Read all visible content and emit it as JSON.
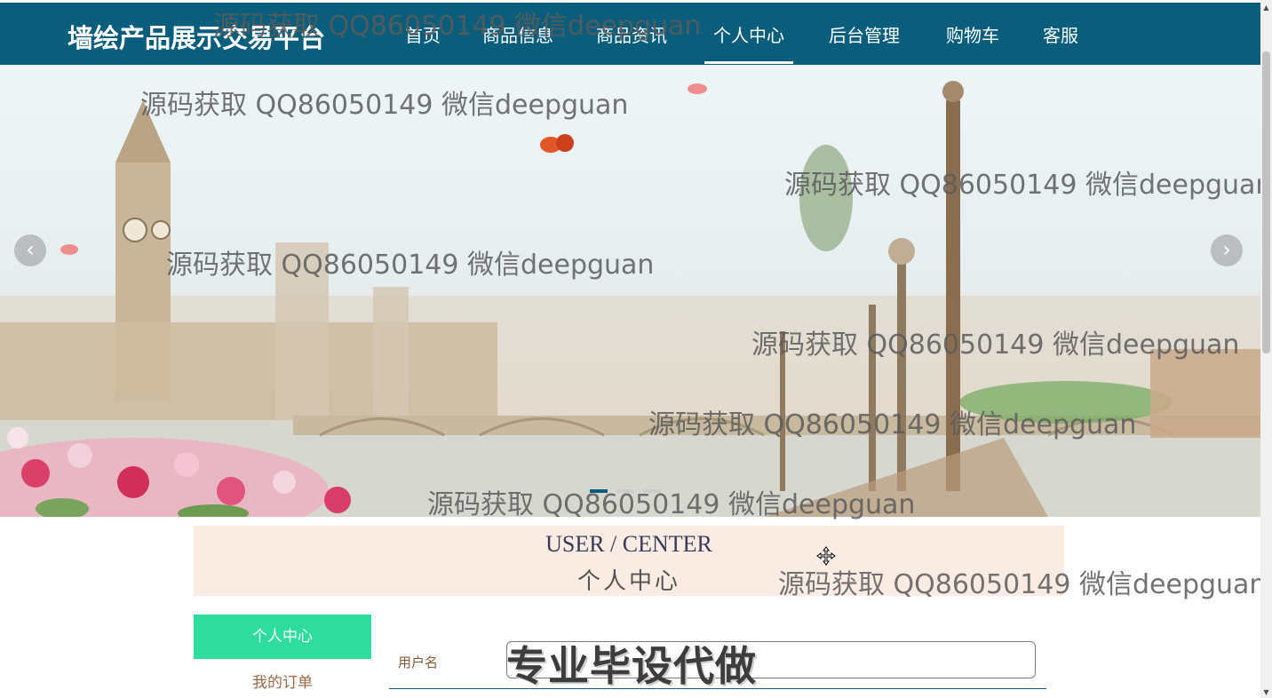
{
  "header": {
    "brand": "墙绘产品展示交易平台",
    "nav": [
      {
        "label": "首页"
      },
      {
        "label": "商品信息"
      },
      {
        "label": "商品资讯"
      },
      {
        "label": "个人中心",
        "active": true
      },
      {
        "label": "后台管理"
      },
      {
        "label": "购物车"
      },
      {
        "label": "客服"
      }
    ]
  },
  "banner": {
    "prev_icon": "chevron-left-icon",
    "next_icon": "chevron-right-icon",
    "prev_glyph": "‹",
    "next_glyph": "›",
    "slide_count": 3,
    "active_slide": 1
  },
  "section": {
    "title_en": "USER / CENTER",
    "title_cn": "个人中心"
  },
  "sidebar": {
    "items": [
      {
        "label": "个人中心",
        "active": true
      },
      {
        "label": "我的订单"
      }
    ]
  },
  "form": {
    "username_label": "用户名",
    "username_value": ""
  },
  "watermarks": {
    "text": "源码获取 QQ86050149 微信deepguan",
    "stamp": "专业毕设代做"
  },
  "colors": {
    "nav_bg": "#0a5e7c",
    "sidebar_active": "#2edc9e",
    "title_box_bg": "#faece3"
  }
}
